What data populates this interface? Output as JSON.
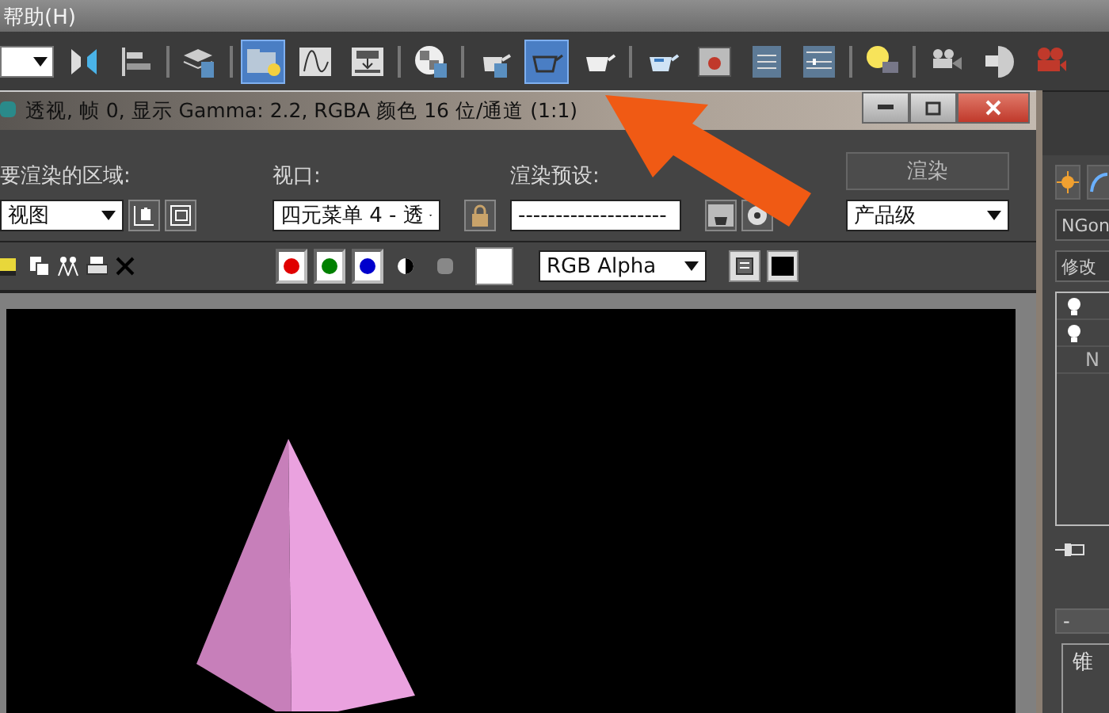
{
  "menu": {
    "items": [
      "帮助(H)"
    ]
  },
  "toolbar": {
    "buttons": [
      {
        "selected": false
      },
      {
        "selected": false
      },
      {
        "selected": false
      },
      {
        "selected": true
      },
      {
        "selected": false
      },
      {
        "selected": false
      },
      {
        "selected": false
      },
      {
        "selected": false
      },
      {
        "selected": true
      },
      {
        "selected": false
      },
      {
        "selected": false
      },
      {
        "selected": false
      },
      {
        "selected": false
      },
      {
        "selected": false
      },
      {
        "selected": false
      },
      {
        "selected": false
      },
      {
        "selected": false
      },
      {
        "selected": false
      }
    ]
  },
  "render_window": {
    "title": "透视, 帧 0, 显示 Gamma: 2.2, RGBA 颜色 16 位/通道 (1:1)",
    "area_label": "要渲染的区域:",
    "area_value": "视图",
    "viewport_label": "视口:",
    "viewport_value": "四元菜单 4 - 透",
    "preset_label": "渲染预设:",
    "preset_value": "--------------------",
    "render_button": "渲染",
    "level_value": "产品级",
    "channels": [
      {
        "color": "#e00000",
        "on": true
      },
      {
        "color": "#008000",
        "on": true
      },
      {
        "color": "#0000cc",
        "on": true
      }
    ],
    "display_value": "RGB Alpha"
  },
  "command_panel": {
    "name_value": "NGon",
    "modifier_value": "修改",
    "stack_text": "N",
    "rollout_toggle": "-",
    "rollout_title": "锥"
  }
}
